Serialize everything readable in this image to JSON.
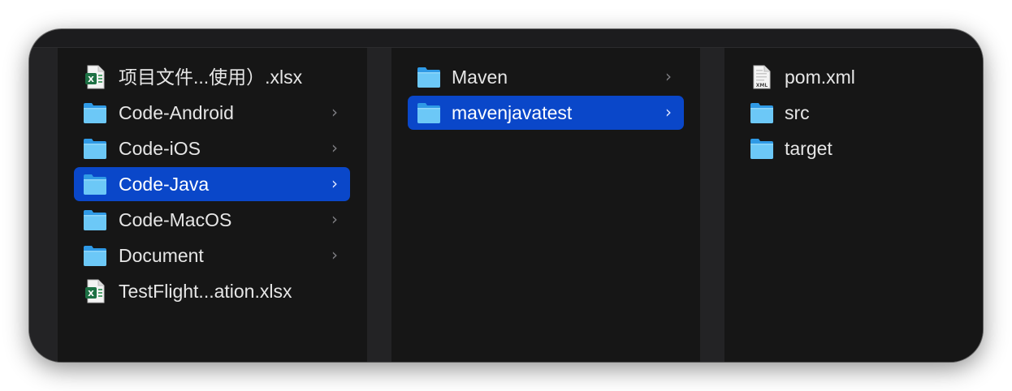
{
  "columns": [
    {
      "items": [
        {
          "label": "项目文件...使用）.xlsx",
          "type": "excel-file",
          "selected": false,
          "has_children": false
        },
        {
          "label": "Code-Android",
          "type": "folder",
          "selected": false,
          "has_children": true
        },
        {
          "label": "Code-iOS",
          "type": "folder",
          "selected": false,
          "has_children": true
        },
        {
          "label": "Code-Java",
          "type": "folder",
          "selected": true,
          "has_children": true
        },
        {
          "label": "Code-MacOS",
          "type": "folder",
          "selected": false,
          "has_children": true
        },
        {
          "label": "Document",
          "type": "folder",
          "selected": false,
          "has_children": true
        },
        {
          "label": "TestFlight...ation.xlsx",
          "type": "excel-file",
          "selected": false,
          "has_children": false
        }
      ]
    },
    {
      "items": [
        {
          "label": "Maven",
          "type": "folder",
          "selected": false,
          "has_children": true
        },
        {
          "label": "mavenjavatest",
          "type": "folder",
          "selected": true,
          "has_children": true
        }
      ]
    },
    {
      "items": [
        {
          "label": "pom.xml",
          "type": "xml-file",
          "selected": false,
          "has_children": false
        },
        {
          "label": "src",
          "type": "folder",
          "selected": false,
          "has_children": false
        },
        {
          "label": "target",
          "type": "folder",
          "selected": false,
          "has_children": false
        }
      ]
    }
  ],
  "icons": {
    "excel_badge": "X",
    "xml_badge": "XML",
    "chevron": "›"
  },
  "colors": {
    "selection": "#0a47c9",
    "folder_light": "#6cc8f7",
    "folder_dark": "#2f9ae6",
    "excel_green": "#1d7044"
  }
}
